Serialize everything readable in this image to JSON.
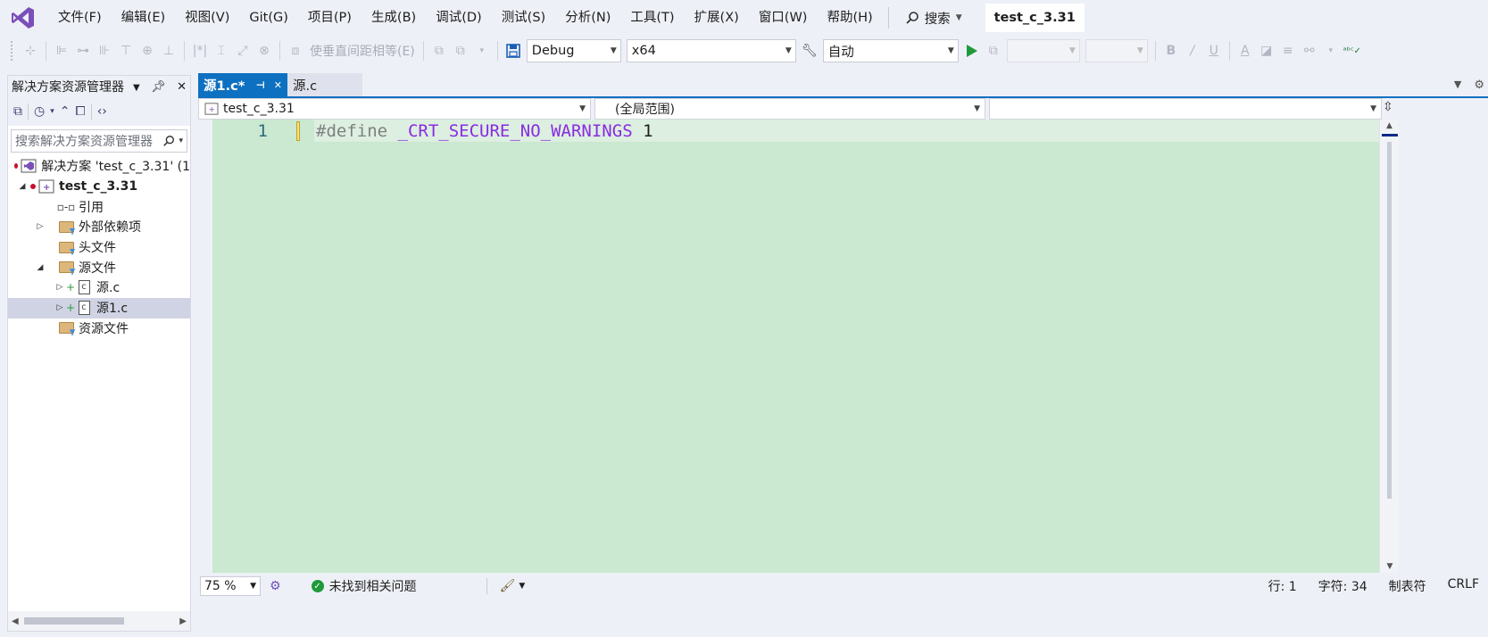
{
  "colors": {
    "accent": "#0e70c0",
    "editor_bg": "#cbe8d0",
    "logo": "#7b4fb8"
  },
  "menu": {
    "items": [
      "文件(F)",
      "编辑(E)",
      "视图(V)",
      "Git(G)",
      "项目(P)",
      "生成(B)",
      "调试(D)",
      "测试(S)",
      "分析(N)",
      "工具(T)",
      "扩展(X)",
      "窗口(W)",
      "帮助(H)"
    ],
    "search_label": "搜索",
    "solution_name": "test_c_3.31"
  },
  "toolbar": {
    "distribute_label": "使垂直间距相等(E)",
    "config": "Debug",
    "platform": "x64",
    "startup": "自动"
  },
  "solution_explorer": {
    "title": "解决方案资源管理器",
    "search_placeholder": "搜索解决方案资源管理器",
    "items": [
      {
        "label": "解决方案 'test_c_3.31' (1",
        "bold": false
      },
      {
        "label": "test_c_3.31",
        "bold": true
      },
      {
        "label": "引用",
        "bold": false
      },
      {
        "label": "外部依赖项",
        "bold": false
      },
      {
        "label": "头文件",
        "bold": false
      },
      {
        "label": "源文件",
        "bold": false
      },
      {
        "label": "源.c",
        "bold": false
      },
      {
        "label": "源1.c",
        "bold": false
      },
      {
        "label": "资源文件",
        "bold": false
      }
    ]
  },
  "editor": {
    "tabs": [
      {
        "label": "源1.c*",
        "active": true
      },
      {
        "label": "源.c",
        "active": false
      }
    ],
    "nav": {
      "project": "test_c_3.31",
      "scope": "(全局范围)",
      "member": ""
    },
    "line_number": "1",
    "code": {
      "directive": "#define",
      "macro": "_CRT_SECURE_NO_WARNINGS",
      "value": "1"
    }
  },
  "statusbar": {
    "zoom": "75 %",
    "issues": "未找到相关问题",
    "line": "行: 1",
    "char": "字符: 34",
    "tabs": "制表符",
    "eol": "CRLF"
  }
}
